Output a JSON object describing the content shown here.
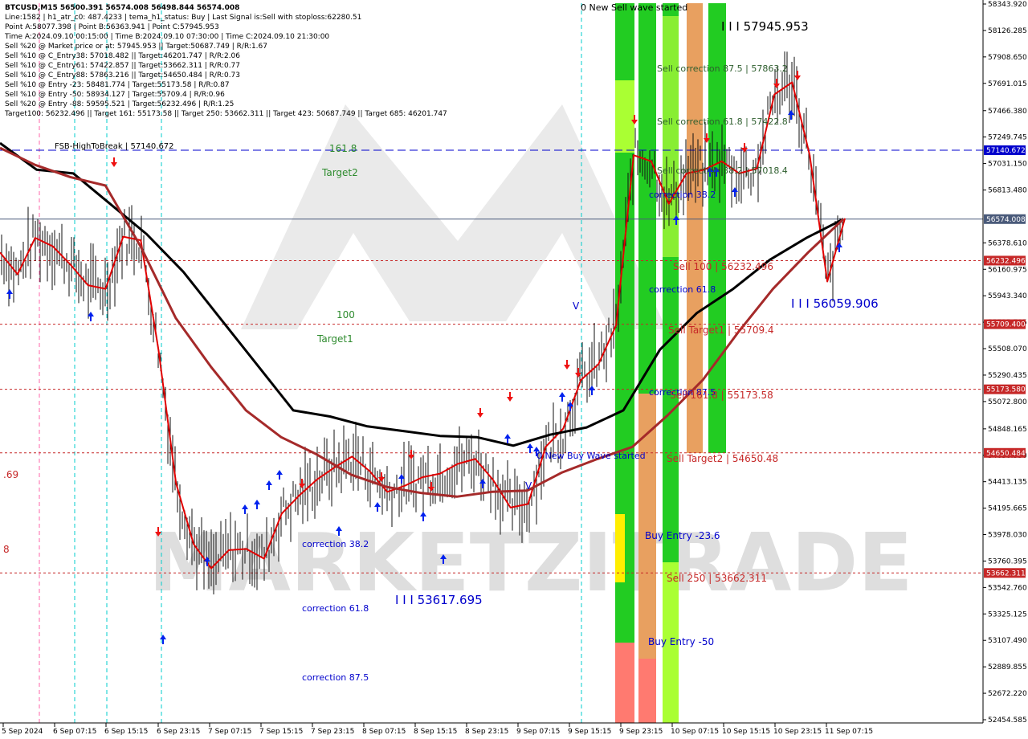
{
  "header": {
    "title": "BTCUSD,M15  56500.391 56574.008 56498.844 56574.008",
    "lines": [
      "Line:1582 | h1_atr_c0: 487.4233 | tema_h1_status: Buy | Last Signal is:Sell with stoploss:62280.51",
      "Point A:58077.398 | Point B:56363.941 | Point C:57945.953",
      "Time A:2024.09.10 00:15:00 | Time B:2024.09.10 07:30:00 | Time C:2024.09.10 21:30:00",
      "Sell %20 @ Market price or at: 57945.953 || Target:50687.749 | R/R:1.67",
      "Sell %10 @ C_Entry38: 57018.482 || Target:46201.747 | R/R:2.06",
      "Sell %10 @ C_Entry61: 57422.857 || Target:53662.311 | R/R:0.77",
      "Sell %10 @ C_Entry88: 57863.216 || Target:54650.484 | R/R:0.73",
      "Sell %10 @ Entry -23: 58481.774 | Target:55173.58 | R/R:0.87",
      "Sell %10 @ Entry -50: 58934.127 | Target:55709.4 | R/R:0.96",
      "Sell %20 @ Entry -88: 59595.521 | Target:56232.496 | R/R:1.25",
      "Target100: 56232.496 || Target 161: 55173.58 || Target 250: 53662.311 || Target 423: 50687.749 || Target 685: 46201.747"
    ]
  },
  "watermark": "MARKETZITRADE",
  "chart_data": {
    "type": "line",
    "symbol": "BTCUSD",
    "timeframe": "M15",
    "ylim": [
      52454.585,
      58343.92
    ],
    "y_ticks": [
      58343.92,
      58126.285,
      57908.65,
      57691.015,
      57466.38,
      57249.745,
      57031.15,
      56813.48,
      56378.61,
      56160.975,
      55943.34,
      55725.705,
      55508.07,
      55290.435,
      55072.8,
      54848.165,
      54630.53,
      54413.135,
      54195.665,
      53978.03,
      53760.395,
      53542.76,
      53325.125,
      53107.49,
      52889.855,
      52672.22,
      52454.585
    ],
    "x_ticks": [
      "5 Sep 2024",
      "6 Sep 07:15",
      "6 Sep 15:15",
      "6 Sep 23:15",
      "7 Sep 07:15",
      "7 Sep 15:15",
      "7 Sep 23:15",
      "8 Sep 07:15",
      "8 Sep 15:15",
      "8 Sep 23:15",
      "9 Sep 07:15",
      "9 Sep 15:15",
      "9 Sep 23:15",
      "10 Sep 07:15",
      "10 Sep 15:15",
      "10 Sep 23:15",
      "11 Sep 07:15"
    ],
    "horizontal_lines": [
      {
        "label": "57140.672",
        "value": 57140.672,
        "color": "#0000cc",
        "style": "dashed"
      },
      {
        "label": "56574.008",
        "value": 56574.008,
        "color": "#4a5a7a",
        "style": "solid"
      },
      {
        "label": "56232.496",
        "value": 56232.496,
        "color": "#c62828",
        "style": "dotted"
      },
      {
        "label": "55709.400",
        "value": 55709.4,
        "color": "#c62828",
        "style": "dotted"
      },
      {
        "label": "55173.580",
        "value": 55173.58,
        "color": "#c62828",
        "style": "dotted"
      },
      {
        "label": "54650.484",
        "value": 54650.484,
        "color": "#c62828",
        "style": "dotted"
      },
      {
        "label": "53662.311",
        "value": 53662.311,
        "color": "#c62828",
        "style": "dotted"
      }
    ],
    "series": [
      {
        "name": "",
        "color": "#e00000",
        "values": [
          56300,
          56120,
          56420,
          56350,
          56200,
          56030,
          56000,
          56430,
          56400,
          55500,
          54400,
          53900,
          53700,
          53850,
          53860,
          53780,
          54150,
          54300,
          54430,
          54530,
          54620,
          54500,
          54330,
          54380,
          54450,
          54480,
          54560,
          54600,
          54430,
          54200,
          54230,
          54700,
          54850,
          55250,
          55380,
          55700,
          57100,
          57050,
          56700,
          56950,
          56980,
          57050,
          56950,
          56990,
          57600,
          57700,
          57100,
          56060,
          56580
        ]
      },
      {
        "name": "",
        "color": "#000000",
        "values": [
          57200,
          56980,
          56950,
          56700,
          56450,
          56140,
          55760,
          55380,
          55000,
          54950,
          54870,
          54830,
          54790,
          54780,
          54710,
          54800,
          54860,
          55000,
          55500,
          55800,
          56000,
          56240,
          56420,
          56574
        ]
      },
      {
        "name": "",
        "color": "#a52a2a",
        "values": [
          57160,
          57020,
          56920,
          56850,
          56350,
          55760,
          55360,
          55000,
          54780,
          54640,
          54470,
          54370,
          54320,
          54290,
          54330,
          54340,
          54490,
          54600,
          54700,
          54960,
          55250,
          55640,
          56000,
          56300,
          56574
        ]
      }
    ]
  },
  "annotations": {
    "new_sell": "0 New Sell wave started",
    "new_buy": "0 New Buy Wave started",
    "point_c": "I I I 57945.953",
    "point_b": "I I I 56059.906",
    "point_low": "I I I 53617.695",
    "fsb": "FSB-HighToBreak  |  57140.672",
    "fib_1618": "161.8",
    "target2": "Target2",
    "fib_100": "100",
    "target1": "Target1",
    "sell_corr_875": "Sell correction 87.5 | 57863.2",
    "sell_corr_618": "Sell correction 61.8 | 57422.8",
    "sell_corr_382": "Sell correction 38.2 | 57018.4",
    "corr_382_r": "correction 38.2",
    "corr_618_r": "correction 61.8",
    "corr_875_r": "correction 87.5",
    "sell_100": "Sell 100 | 56232.496",
    "sell_t1": "Sell Target1 | 55709.4",
    "sell_1618": "Sell 161.8 | 55173.58",
    "sell_t2": "Sell Target2 | 54650.48",
    "sell_250": "Sell 250 | 53662.311",
    "buy_entry_236": "Buy Entry -23.6",
    "buy_entry_50": "Buy Entry -50",
    "corr_382_l": "correction 38.2",
    "corr_618_l": "correction 61.8",
    "corr_875_l": "correction 87.5",
    "left_69": ".69",
    "left_8": "8",
    "c_letter": "V",
    "d_letter": "V"
  },
  "colors": {
    "green": "#22cc22",
    "lime": "#aaff33",
    "salmon": "#ff7a70",
    "orange": "#e8a060",
    "yellow": "#ffee00",
    "red_label": "#c62828",
    "blue_label": "#0000cc"
  }
}
